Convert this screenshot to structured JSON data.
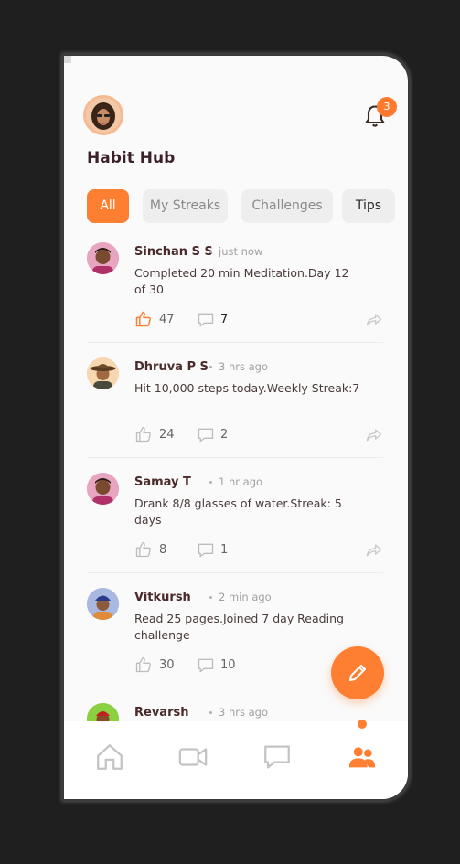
{
  "header": {
    "title": "Habit Hub",
    "notification_count": "3"
  },
  "filters": [
    {
      "label": "All",
      "active": true
    },
    {
      "label": "My Streaks",
      "active": false
    },
    {
      "label": "Challenges",
      "active": false
    },
    {
      "label": "Tips",
      "active": false
    }
  ],
  "posts": [
    {
      "name": "Sinchan S S",
      "time": "just now",
      "text": "Completed 20 min Meditation.Day 12 of 30",
      "likes": "47",
      "comments": "7",
      "liked": true
    },
    {
      "name": "Dhruva P S",
      "time": "3 hrs ago",
      "text": "Hit 10,000 steps today.Weekly Streak:7",
      "likes": "24",
      "comments": "2",
      "liked": false
    },
    {
      "name": "Samay T",
      "time": "1 hr ago",
      "text": "Drank 8/8 glasses of water.Streak: 5 days",
      "likes": "8",
      "comments": "1",
      "liked": false
    },
    {
      "name": "Vitkursh",
      "time": "2 min ago",
      "text": "Read 25 pages.Joined 7 day Reading challenge",
      "likes": "30",
      "comments": "10",
      "liked": false
    },
    {
      "name": "Revarsh",
      "time": "3 hrs ago",
      "text": "",
      "likes": "",
      "comments": "",
      "liked": false
    }
  ],
  "nav": [
    "home-icon",
    "video-icon",
    "chat-icon",
    "community-icon"
  ],
  "colors": {
    "accent": "#ff7f32",
    "title": "#3b1f2b",
    "background": "#fafafa"
  }
}
